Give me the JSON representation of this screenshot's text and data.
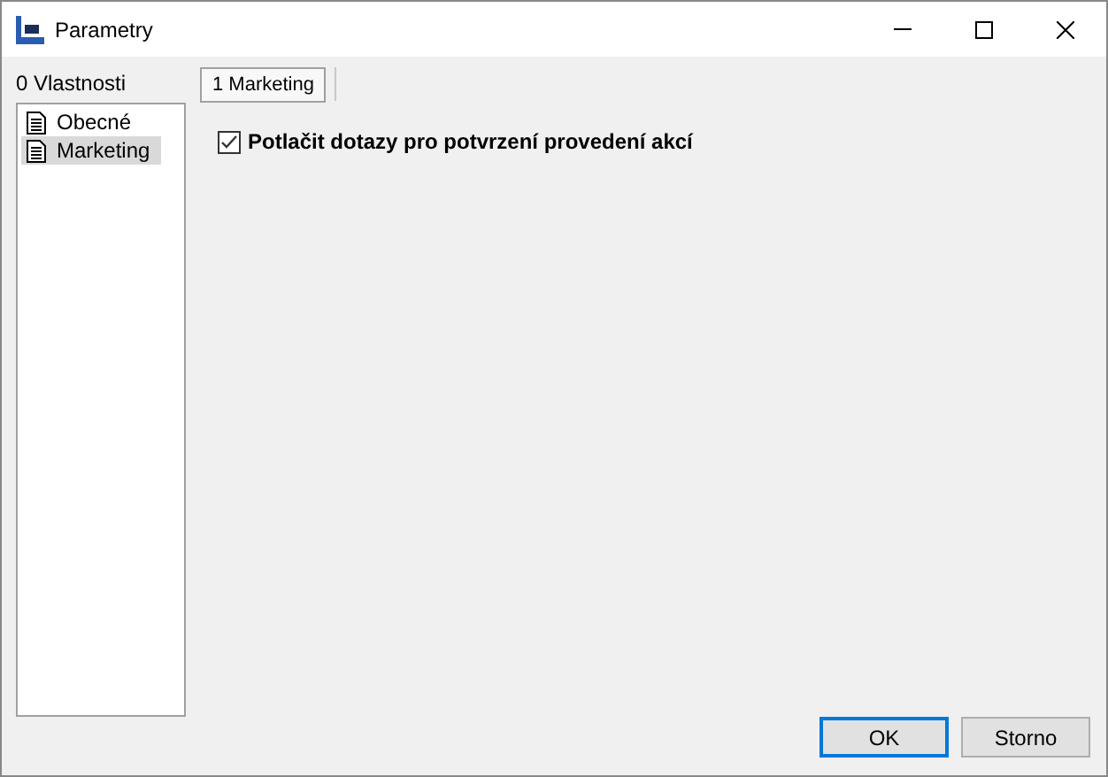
{
  "window": {
    "title": "Parametry"
  },
  "sidebar": {
    "label": "0 Vlastnosti",
    "items": [
      {
        "label": "Obecné",
        "selected": false
      },
      {
        "label": "Marketing",
        "selected": true
      }
    ]
  },
  "tabs": [
    {
      "label": "1 Marketing",
      "selected": true
    }
  ],
  "options": [
    {
      "label": "Potlačit dotazy pro potvrzení provedení akcí",
      "checked": true
    }
  ],
  "buttons": [
    {
      "label": "OK",
      "kind": "default"
    },
    {
      "label": "Storno",
      "kind": "normal"
    }
  ]
}
